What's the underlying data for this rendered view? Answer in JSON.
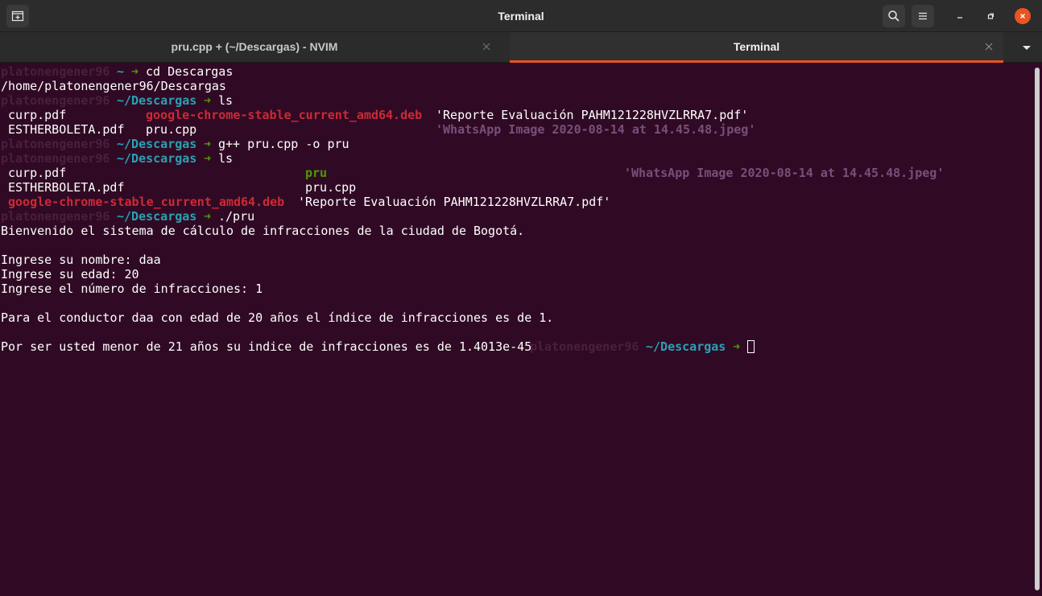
{
  "window": {
    "title": "Terminal",
    "new_tab_icon": "new-tab-icon",
    "search_icon": "search-icon",
    "menu_icon": "hamburger-menu-icon",
    "minimize_icon": "minimize-icon",
    "maximize_icon": "maximize-icon",
    "close_icon": "close-icon"
  },
  "tabs": [
    {
      "label": "pru.cpp + (~/Descargas) - NVIM",
      "active": false
    },
    {
      "label": "Terminal",
      "active": true
    }
  ],
  "colors": {
    "background": "#300a24",
    "accent": "#e95420",
    "prompt_user": "#4a1f3e",
    "prompt_path": "#2aa1b3",
    "prompt_arrow": "#4e9a06",
    "archive_red": "#cc2a35",
    "executable_green": "#4e9a06",
    "image_purple": "#75507b"
  },
  "terminal": {
    "prompt_user": "platonengener96",
    "arrow": "➜",
    "home_path": "~",
    "dir_path": "~/Descargas",
    "cmd_cd": "cd Descargas",
    "pwd_output": "/home/platonengener96/Descargas",
    "cmd_ls": "ls",
    "ls1": {
      "curp": "curp.pdf",
      "chrome": "google-chrome-stable_current_amd64.deb",
      "reporte": "'Reporte Evaluación PAHM121228HVZLRRA7.pdf'",
      "esther": "ESTHERBOLETA.pdf",
      "pru_cpp": "pru.cpp",
      "whatsapp": "'WhatsApp Image 2020-08-14 at 14.45.48.jpeg'"
    },
    "cmd_compile": "g++ pru.cpp -o pru",
    "ls2": {
      "curp": "curp.pdf",
      "pru": "pru",
      "whatsapp": "'WhatsApp Image 2020-08-14 at 14.45.48.jpeg'",
      "esther": "ESTHERBOLETA.pdf",
      "pru_cpp": "pru.cpp",
      "chrome": "google-chrome-stable_current_amd64.deb",
      "reporte": "'Reporte Evaluación PAHM121228HVZLRRA7.pdf'"
    },
    "cmd_run": "./pru",
    "program_output": {
      "welcome": "Bienvenido el sistema de cálculo de infracciones de la ciudad de Bogotá.",
      "name_prompt": "Ingrese su nombre: daa",
      "age_prompt": "Ingrese su edad: 20",
      "infractions_prompt": "Ingrese el número de infracciones: 1",
      "result": "Para el conductor daa con edad de 20 años el índice de infracciones es de 1.",
      "minor_result": "Por ser usted menor de 21 años su indice de infracciones es de 1.4013e-45"
    }
  }
}
